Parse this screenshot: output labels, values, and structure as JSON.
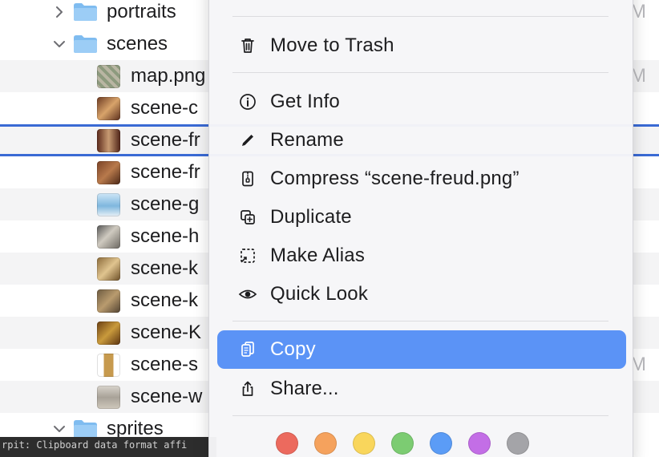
{
  "finder": {
    "rows": [
      {
        "kind": "folder",
        "name": "portraits",
        "expanded": false,
        "extra": "M"
      },
      {
        "kind": "folder",
        "name": "scenes",
        "expanded": true,
        "extra": ""
      },
      {
        "kind": "file",
        "name": "map.png",
        "extra": "M"
      },
      {
        "kind": "file",
        "name": "scene-c",
        "extra": ""
      },
      {
        "kind": "file",
        "name": "scene-fr",
        "extra": "",
        "selected": true
      },
      {
        "kind": "file",
        "name": "scene-fr",
        "extra": ""
      },
      {
        "kind": "file",
        "name": "scene-g",
        "extra": ""
      },
      {
        "kind": "file",
        "name": "scene-h",
        "extra": ""
      },
      {
        "kind": "file",
        "name": "scene-k",
        "extra": ""
      },
      {
        "kind": "file",
        "name": "scene-k",
        "extra": ""
      },
      {
        "kind": "file",
        "name": "scene-K",
        "extra": ""
      },
      {
        "kind": "file",
        "name": "scene-s",
        "extra": "M"
      },
      {
        "kind": "file",
        "name": "scene-w",
        "extra": ""
      },
      {
        "kind": "folder",
        "name": "sprites",
        "expanded": true,
        "extra": ""
      }
    ],
    "console_text": "rpit: Clipboard data format affi"
  },
  "menu": {
    "items": [
      {
        "label": "Move to Trash",
        "icon": "trash-icon"
      },
      {
        "label": "Get Info",
        "icon": "info-icon"
      },
      {
        "label": "Rename",
        "icon": "pencil-icon"
      },
      {
        "label": "Compress “scene-freud.png”",
        "icon": "zip-icon"
      },
      {
        "label": "Duplicate",
        "icon": "duplicate-icon"
      },
      {
        "label": "Make Alias",
        "icon": "alias-icon"
      },
      {
        "label": "Quick Look",
        "icon": "eye-icon"
      },
      {
        "label": "Copy",
        "icon": "copy-icon",
        "highlighted": true
      },
      {
        "label": "Share...",
        "icon": "share-icon"
      }
    ],
    "tags": [
      {
        "name": "Red",
        "color": "#ec6a5e"
      },
      {
        "name": "Orange",
        "color": "#f5a25d"
      },
      {
        "name": "Yellow",
        "color": "#f9d65c"
      },
      {
        "name": "Green",
        "color": "#7ccc72"
      },
      {
        "name": "Blue",
        "color": "#5b9cf6"
      },
      {
        "name": "Purple",
        "color": "#c36ee6"
      },
      {
        "name": "Gray",
        "color": "#a4a4a8"
      }
    ]
  },
  "colors": {
    "selection_outline": "#3a6ad4",
    "highlight": "#5b93f6",
    "folder_blue": "#7fbcf0"
  }
}
